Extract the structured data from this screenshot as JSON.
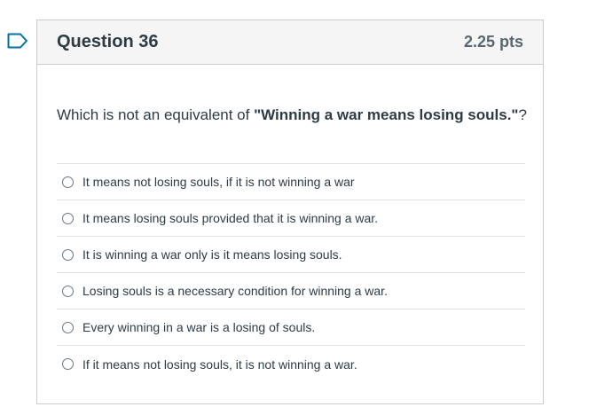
{
  "question": {
    "title": "Question 36",
    "points": "2.25 pts",
    "text_before": "Which is not an equivalent of ",
    "text_bold": "\"Winning a war means losing souls.\"",
    "text_after": "?"
  },
  "answers": [
    {
      "label": "It means not losing souls, if it is not winning a war"
    },
    {
      "label": "It means losing souls provided that it is winning a war."
    },
    {
      "label": "It is winning a war only is it means losing souls."
    },
    {
      "label": "Losing souls is a necessary condition for winning a war."
    },
    {
      "label": "Every winning in a war is a losing of souls."
    },
    {
      "label": "If it means not losing souls, it is not winning a war."
    }
  ],
  "icons": {
    "bookmark": "bookmark-flag-icon",
    "radio": "radio-button"
  },
  "colors": {
    "accent": "#0770a3",
    "header_bg": "#f5f5f5",
    "border": "#c7cdd1"
  }
}
